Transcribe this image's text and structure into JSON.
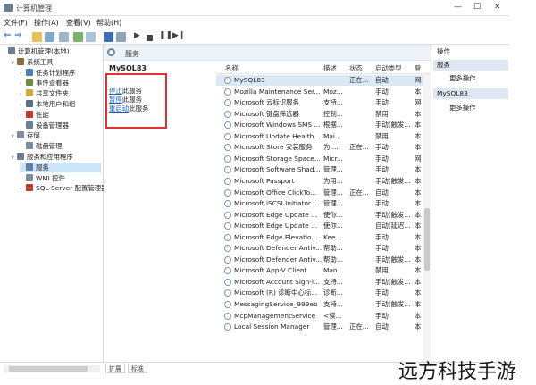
{
  "window": {
    "title": "计算机管理",
    "controls": [
      "—",
      "☐",
      "✕"
    ]
  },
  "menu": [
    "文件(F)",
    "操作(A)",
    "查看(V)",
    "帮助(H)"
  ],
  "toolbar_icons": [
    "back-icon",
    "forward-icon",
    "folder-icon",
    "grid-icon",
    "list-icon",
    "refresh-icon",
    "export-icon",
    "help-icon",
    "properties-icon",
    "play-icon",
    "stop-icon",
    "pause-icon",
    "restart-icon"
  ],
  "tree": [
    {
      "label": "计算机管理(本地)",
      "indent": 0,
      "exp": "",
      "color": "#6b7e92"
    },
    {
      "label": "系统工具",
      "indent": 1,
      "exp": "∨",
      "color": "#8a6d3b"
    },
    {
      "label": "任务计划程序",
      "indent": 2,
      "exp": "›",
      "color": "#4c7fb8"
    },
    {
      "label": "事件查看器",
      "indent": 2,
      "exp": "›",
      "color": "#6a8f3a"
    },
    {
      "label": "共享文件夹",
      "indent": 2,
      "exp": "›",
      "color": "#d6a93a"
    },
    {
      "label": "本地用户和组",
      "indent": 2,
      "exp": "›",
      "color": "#5c6d8a"
    },
    {
      "label": "性能",
      "indent": 2,
      "exp": "›",
      "color": "#c0392b"
    },
    {
      "label": "设备管理器",
      "indent": 2,
      "exp": "",
      "color": "#6b7e92"
    },
    {
      "label": "存储",
      "indent": 1,
      "exp": "∨",
      "color": "#7a8c9e"
    },
    {
      "label": "磁盘管理",
      "indent": 2,
      "exp": "",
      "color": "#7a8c9e"
    },
    {
      "label": "服务和应用程序",
      "indent": 1,
      "exp": "∨",
      "color": "#6b7e92"
    },
    {
      "label": "服务",
      "indent": 2,
      "exp": "",
      "color": "#5c7ea8",
      "sel": true
    },
    {
      "label": "WMI 控件",
      "indent": 2,
      "exp": "",
      "color": "#7a8c9e"
    },
    {
      "label": "SQL Server 配置管理器",
      "indent": 2,
      "exp": "›",
      "color": "#c0392b"
    }
  ],
  "services_header": "服务",
  "selected_service": "MySQL83",
  "extended_actions": [
    {
      "link": "停止",
      "rest": "此服务"
    },
    {
      "link": "暂停",
      "rest": "此服务"
    },
    {
      "link": "重启动",
      "rest": "此服务"
    }
  ],
  "columns": [
    "名称",
    "描述",
    "状态",
    "启动类型",
    "登"
  ],
  "rows": [
    [
      "MySQL83",
      "",
      "正在...",
      "自动",
      "网"
    ],
    [
      "Mozilla Maintenance Ser...",
      "Moz...",
      "",
      "手动",
      "本"
    ],
    [
      "Microsoft 云标识服务",
      "支持...",
      "",
      "手动",
      "网"
    ],
    [
      "Microsoft 键盘筛选器",
      "控制...",
      "",
      "禁用",
      "本"
    ],
    [
      "Microsoft Windows SMS ...",
      "根据...",
      "",
      "手动(触发...",
      "本"
    ],
    [
      "Microsoft Update Health...",
      "Mai...",
      "",
      "禁用",
      "本"
    ],
    [
      "Microsoft Store 安装服务",
      "为 ...",
      "正在...",
      "手动",
      "本"
    ],
    [
      "Microsoft Storage Space...",
      "Micr...",
      "",
      "手动",
      "网"
    ],
    [
      "Microsoft Software Shad...",
      "管理...",
      "",
      "手动",
      "本"
    ],
    [
      "Microsoft Passport",
      "为用...",
      "",
      "手动(触发...",
      "本"
    ],
    [
      "Microsoft Office ClickTo...",
      "管理...",
      "正在...",
      "自动",
      "本"
    ],
    [
      "Microsoft iSCSI Initiator ...",
      "管理...",
      "",
      "手动",
      "本"
    ],
    [
      "Microsoft Edge Update ...",
      "使你...",
      "",
      "手动(触发...",
      "本"
    ],
    [
      "Microsoft Edge Update ...",
      "使你...",
      "",
      "自动(延迟...",
      "本"
    ],
    [
      "Microsoft Edge Elevatio...",
      "Kee...",
      "",
      "手动",
      "本"
    ],
    [
      "Microsoft Defender Antiv...",
      "帮助...",
      "",
      "手动",
      "本"
    ],
    [
      "Microsoft Defender Antiv...",
      "帮助...",
      "",
      "手动(触发...",
      "本"
    ],
    [
      "Microsoft App-V Client",
      "Man...",
      "",
      "禁用",
      "本"
    ],
    [
      "Microsoft Account Sign-i...",
      "支持...",
      "",
      "手动(触发...",
      "本"
    ],
    [
      "Microsoft (R) 诊断中心标...",
      "诊断...",
      "",
      "手动",
      "本"
    ],
    [
      "MessagingService_999eb",
      "支持...",
      "",
      "手动(触发...",
      "本"
    ],
    [
      "McpManagementService",
      "<读...",
      "",
      "手动",
      "本"
    ],
    [
      "Local Session Manager",
      "管理...",
      "正在...",
      "自动",
      "本"
    ]
  ],
  "actions": {
    "title": "操作",
    "group1": "服务",
    "group1_items": [
      "更多操作"
    ],
    "group2": "MySQL83",
    "group2_items": [
      "更多操作"
    ]
  },
  "bottom_tabs": [
    "扩展",
    "标准"
  ],
  "watermark": "远方科技手游",
  "colors": {
    "selection": "#cce4f7",
    "link": "#1a5fb4",
    "highlight_box": "#e03030",
    "actions_header": "#dfe8f2"
  }
}
